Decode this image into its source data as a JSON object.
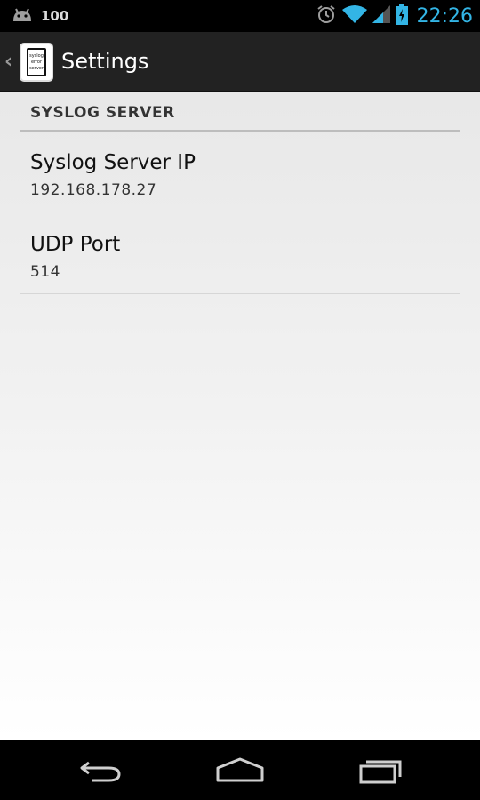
{
  "status_bar": {
    "notification_count": "100",
    "time": "22:26"
  },
  "action_bar": {
    "title": "Settings",
    "app_icon_lines": [
      "syslog",
      "error",
      "server"
    ]
  },
  "preferences": {
    "category": "SYSLOG SERVER",
    "items": [
      {
        "title": "Syslog Server IP",
        "summary": "192.168.178.27"
      },
      {
        "title": "UDP Port",
        "summary": "514"
      }
    ]
  },
  "colors": {
    "accent": "#33b5e5",
    "action_bar": "#222222"
  },
  "icons": {
    "status_left": "android-icon",
    "alarm": "alarm-clock-icon",
    "wifi": "wifi-icon",
    "signal": "cell-signal-icon",
    "battery": "battery-charging-icon",
    "back": "back-icon",
    "home": "home-icon",
    "recents": "recent-apps-icon"
  }
}
